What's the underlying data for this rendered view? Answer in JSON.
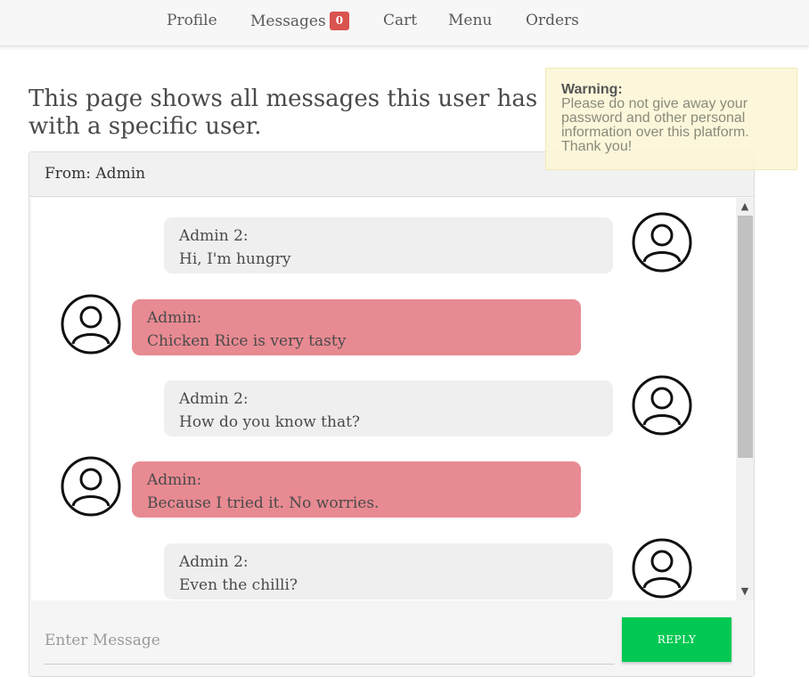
{
  "nav": {
    "items": [
      {
        "label": "Profile"
      },
      {
        "label": "Messages",
        "badge": "0"
      },
      {
        "label": "Cart"
      },
      {
        "label": "Menu"
      },
      {
        "label": "Orders"
      }
    ]
  },
  "page": {
    "title": "This page shows all messages this user has with a specific user."
  },
  "warning": {
    "title": "Warning:",
    "text": "Please do not give away your password and other personal information over this platform. Thank you!"
  },
  "chat": {
    "header": "From: Admin",
    "messages": [
      {
        "sender": "Admin 2:",
        "text": "Hi, I'm hungry",
        "side": "right"
      },
      {
        "sender": "Admin:",
        "text": "Chicken Rice is very tasty",
        "side": "left"
      },
      {
        "sender": "Admin 2:",
        "text": "How do you know that?",
        "side": "right"
      },
      {
        "sender": "Admin:",
        "text": "Because I tried it. No worries.",
        "side": "left"
      },
      {
        "sender": "Admin 2:",
        "text": "Even the chilli?",
        "side": "right"
      }
    ]
  },
  "composer": {
    "placeholder": "Enter Message",
    "reply_label": "REPLY"
  },
  "colors": {
    "badge": "#d9534f",
    "own_bubble": "#efefef",
    "other_bubble": "#e88a92",
    "reply_button": "#00c853",
    "warning_bg": "#fcf6d6"
  },
  "icons": {
    "avatar": "user-avatar-icon",
    "scroll_up": "chevron-up-icon",
    "scroll_down": "chevron-down-icon"
  }
}
